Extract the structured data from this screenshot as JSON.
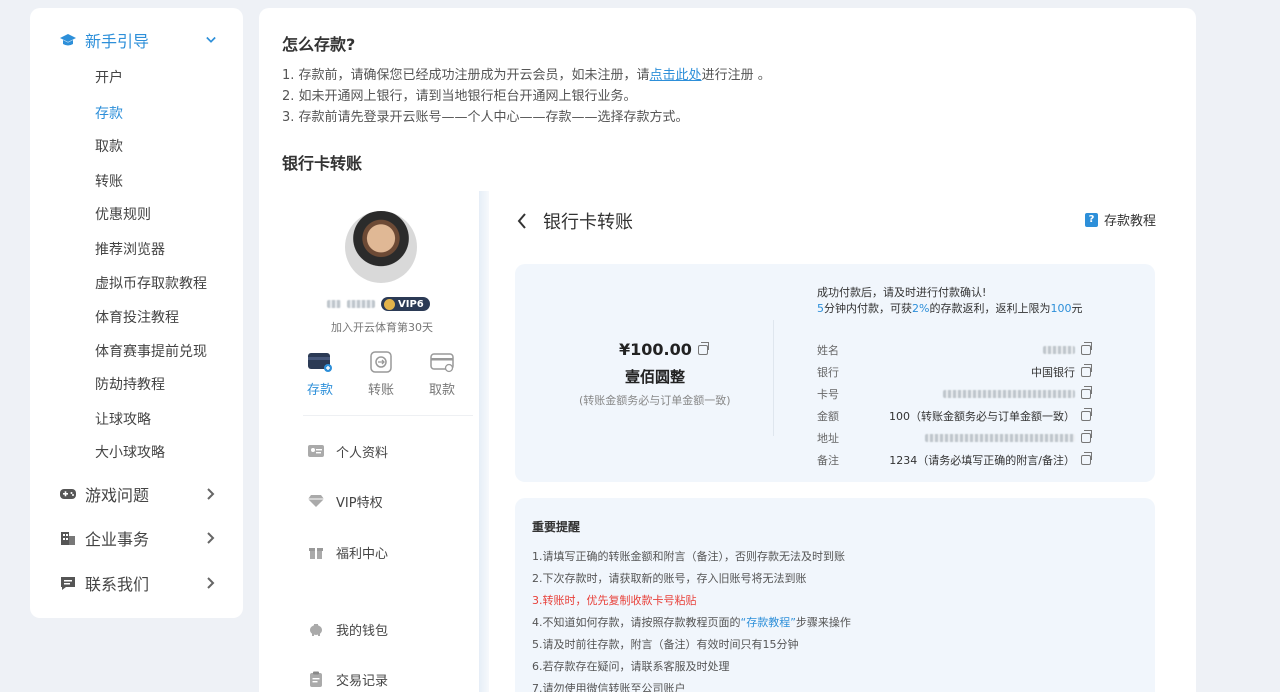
{
  "sidebar": {
    "groups": [
      {
        "label": "新手引导",
        "icon": "graduation-cap-icon",
        "expanded": true
      },
      {
        "label": "游戏问题",
        "icon": "gamepad-icon",
        "expanded": false
      },
      {
        "label": "企业事务",
        "icon": "building-icon",
        "expanded": false
      },
      {
        "label": "联系我们",
        "icon": "chat-icon",
        "expanded": false
      }
    ],
    "items": [
      "开户",
      "存款",
      "取款",
      "转账",
      "优惠规则",
      "推荐浏览器",
      "虚拟币存取款教程",
      "体育投注教程",
      "体育赛事提前兑现",
      "防劫持教程",
      "让球攻略",
      "大小球攻略"
    ],
    "active_item": "存款"
  },
  "main": {
    "title": "怎么存款?",
    "step1_pre": "1. 存款前，请确保您已经成功注册成为开云会员，如未注册，请",
    "step1_link": "点击此处",
    "step1_post": "进行注册 。",
    "step2": "2. 如未开通网上银行，请到当地银行柜台开通网上银行业务。",
    "step3": "3. 存款前请先登录开云账号——个人中心——存款——选择存款方式。",
    "section_title": "银行卡转账"
  },
  "profile": {
    "vip_label": "VIP6",
    "joined": "加入开云体育第30天",
    "actions": [
      {
        "label": "存款",
        "icon": "wallet-deposit-icon",
        "active": true
      },
      {
        "label": "转账",
        "icon": "transfer-icon",
        "active": false
      },
      {
        "label": "取款",
        "icon": "card-withdraw-icon",
        "active": false
      }
    ],
    "menu": [
      {
        "label": "个人资料",
        "icon": "id-card-icon"
      },
      {
        "label": "VIP特权",
        "icon": "diamond-icon"
      },
      {
        "label": "福利中心",
        "icon": "gift-icon"
      },
      {
        "label": "我的钱包",
        "icon": "piggy-bank-icon"
      },
      {
        "label": "交易记录",
        "icon": "clipboard-icon"
      }
    ]
  },
  "transfer": {
    "back_title": "银行卡转账",
    "tutorial_label": "存款教程",
    "amount": "¥100.00",
    "amount_cn": "壹佰圆整",
    "amount_note": "(转账金额务必与订单金额一致)",
    "notice1": "成功付款后，请及时进行付款确认!",
    "notice2_a": "5",
    "notice2_b": "分钟内付款，可获",
    "notice2_c": "2%",
    "notice2_d": "的存款返利，返利上限为",
    "notice2_e": "100",
    "notice2_f": "元",
    "fields": [
      {
        "key": "姓名",
        "value": ""
      },
      {
        "key": "银行",
        "value": "中国银行"
      },
      {
        "key": "卡号",
        "value": ""
      },
      {
        "key": "金额",
        "value": "100（转账金额务必与订单金额一致）"
      },
      {
        "key": "地址",
        "value": ""
      },
      {
        "key": "备注",
        "value": "1234（请务必填写正确的附言/备注）"
      }
    ]
  },
  "reminders": {
    "title": "重要提醒",
    "items": [
      "1.请填写正确的转账金额和附言（备注），否则存款无法及时到账",
      "2.下次存款时，请获取新的账号，存入旧账号将无法到账",
      "3.转账时，优先复制收款卡号粘贴",
      "4.不知道如何存款，请按照存款教程页面的",
      "5.请及时前往存款，附言（备注）有效时间只有15分钟",
      "6.若存款存在疑问，请联系客服及时处理",
      "7.请勿使用微信转账至公司账户"
    ],
    "item4_link": "“存款教程”",
    "item4_post": "步骤来操作"
  },
  "colors": {
    "accent": "#2d8fd9",
    "warning": "#e8413a",
    "panel": "#f1f6fc"
  }
}
